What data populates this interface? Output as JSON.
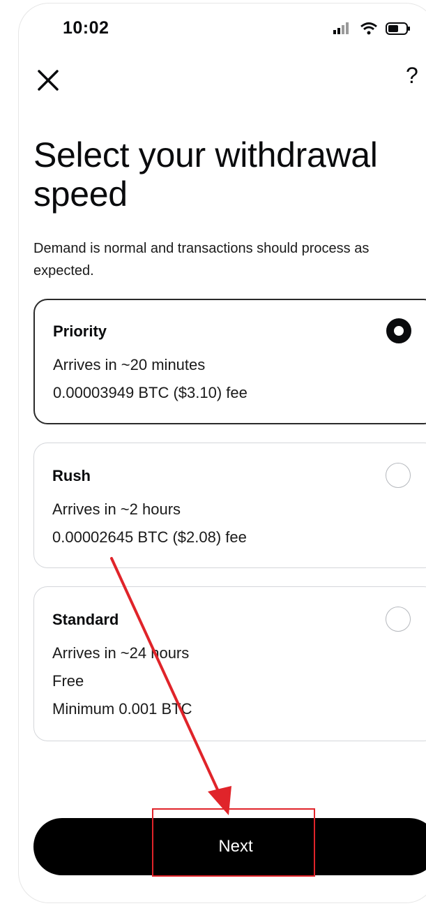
{
  "status_bar": {
    "time": "10:02"
  },
  "header": {
    "close_icon": "close-icon",
    "help_label": "?"
  },
  "page": {
    "title": "Select your withdrawal speed",
    "subtitle": "Demand is normal and transactions should process as expected."
  },
  "options": [
    {
      "title": "Priority",
      "lines": [
        "Arrives in ~20 minutes",
        "0.00003949 BTC ($3.10) fee"
      ],
      "selected": true
    },
    {
      "title": "Rush",
      "lines": [
        "Arrives in ~2 hours",
        "0.00002645 BTC ($2.08) fee"
      ],
      "selected": false
    },
    {
      "title": "Standard",
      "lines": [
        "Arrives in ~24 hours",
        "Free",
        "Minimum 0.001 BTC"
      ],
      "selected": false
    }
  ],
  "footer": {
    "next_label": "Next"
  },
  "colors": {
    "annotation": "#e0242a",
    "primary": "#000000"
  }
}
